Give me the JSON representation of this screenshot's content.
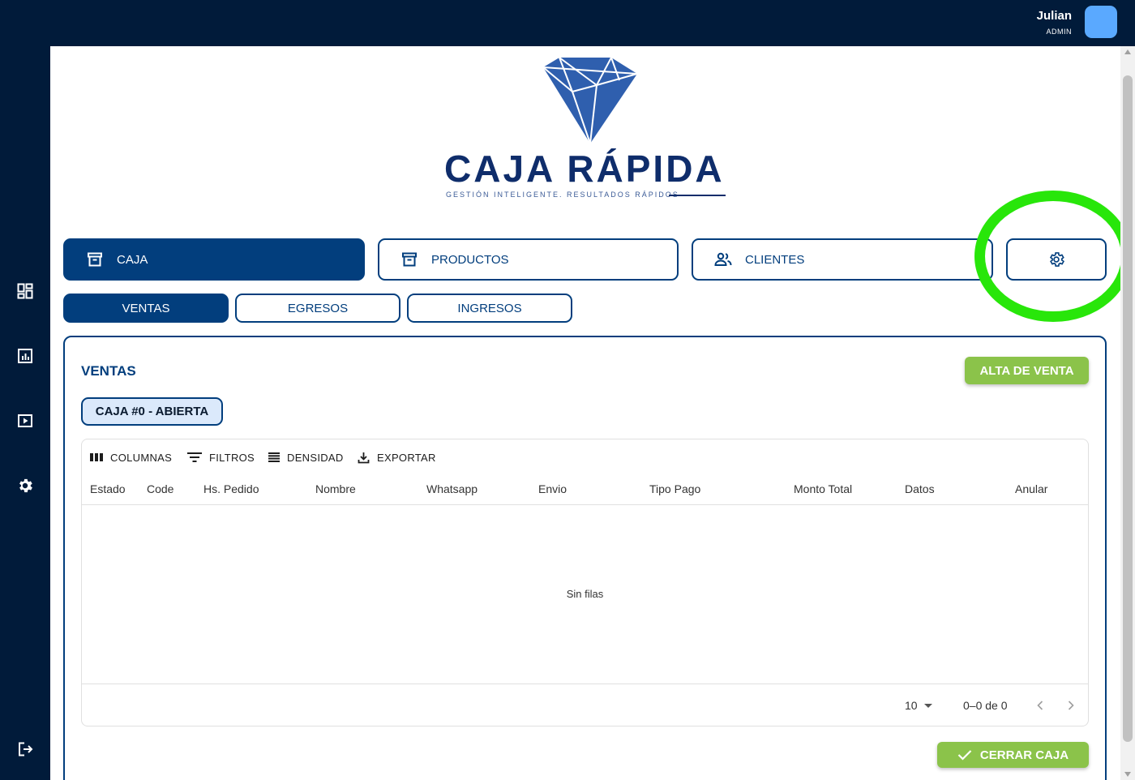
{
  "user": {
    "name": "Julian",
    "role": "ADMIN"
  },
  "sidebar": {
    "items": [
      {
        "icon": "dashboard-icon"
      },
      {
        "icon": "report-icon"
      },
      {
        "icon": "video-icon"
      },
      {
        "icon": "gear-icon"
      }
    ],
    "logout_icon": "logout-icon"
  },
  "brand": {
    "title": "CAJA RÁPIDA",
    "tagline": "GESTIÓN INTELIGENTE. RESULTADOS RÁPIDOS",
    "color": "#0f2d6b"
  },
  "nav": {
    "tabs": [
      {
        "label": "CAJA",
        "icon": "archive-icon",
        "active": true
      },
      {
        "label": "PRODUCTOS",
        "icon": "archive-icon",
        "active": false
      },
      {
        "label": "CLIENTES",
        "icon": "users-icon",
        "active": false
      }
    ],
    "settings_icon": "gear-icon"
  },
  "subtabs": [
    {
      "label": "VENTAS",
      "active": true
    },
    {
      "label": "EGRESOS",
      "active": false
    },
    {
      "label": "INGRESOS",
      "active": false
    }
  ],
  "ventas": {
    "title": "VENTAS",
    "alta_label": "ALTA DE VENTA",
    "caja_status": "CAJA #0 - ABIERTA",
    "toolbar": {
      "columns": "COLUMNAS",
      "filters": "FILTROS",
      "density": "DENSIDAD",
      "export": "EXPORTAR"
    },
    "columns": [
      "Estado",
      "Code",
      "Hs. Pedido",
      "Nombre",
      "Whatsapp",
      "Envio",
      "Tipo Pago",
      "Monto Total",
      "Datos",
      "Anular"
    ],
    "empty_text": "Sin filas",
    "rows_per_page": "10",
    "range_text": "0–0 de 0",
    "close_label": "CERRAR CAJA"
  },
  "colors": {
    "primary": "#023e7d",
    "dark": "#011b3a",
    "success": "#8bc34a",
    "highlight": "#28e60a",
    "avatar": "#5aa9ff"
  }
}
